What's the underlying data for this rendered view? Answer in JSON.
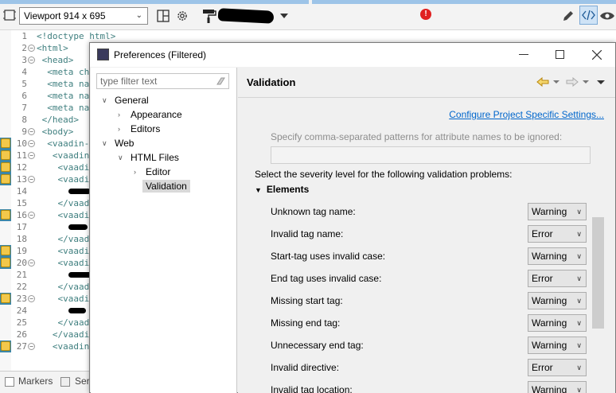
{
  "toolbar": {
    "viewport_label": "Viewport 914 x 695",
    "badge_text": "!"
  },
  "editor": {
    "lines": [
      {
        "n": "1",
        "text": "<!doctype html>",
        "fold": false,
        "warn": false
      },
      {
        "n": "2",
        "text": "<html>",
        "fold": true,
        "warn": false
      },
      {
        "n": "3",
        "text": " <head>",
        "fold": true,
        "warn": false
      },
      {
        "n": "4",
        "text": "  <meta ch",
        "fold": false,
        "warn": false
      },
      {
        "n": "5",
        "text": "  <meta na",
        "fold": false,
        "warn": false
      },
      {
        "n": "6",
        "text": "  <meta na",
        "fold": false,
        "warn": false
      },
      {
        "n": "7",
        "text": "  <meta na",
        "fold": false,
        "warn": false
      },
      {
        "n": "8",
        "text": " </head>",
        "fold": false,
        "warn": false
      },
      {
        "n": "9",
        "text": " <body>",
        "fold": true,
        "warn": false
      },
      {
        "n": "10",
        "text": "  <vaadin-",
        "fold": true,
        "warn": true
      },
      {
        "n": "11",
        "text": "   <vaadin",
        "fold": true,
        "warn": true
      },
      {
        "n": "12",
        "text": "    <vaadi",
        "fold": false,
        "warn": true
      },
      {
        "n": "13",
        "text": "    <vaadi",
        "fold": true,
        "warn": true
      },
      {
        "n": "14",
        "text": "",
        "fold": false,
        "warn": false
      },
      {
        "n": "15",
        "text": "    </vaad",
        "fold": false,
        "warn": false
      },
      {
        "n": "16",
        "text": "    <vaadi",
        "fold": true,
        "warn": true
      },
      {
        "n": "17",
        "text": "",
        "fold": false,
        "warn": false
      },
      {
        "n": "18",
        "text": "    </vaad",
        "fold": false,
        "warn": false
      },
      {
        "n": "19",
        "text": "    <vaadi",
        "fold": false,
        "warn": true
      },
      {
        "n": "20",
        "text": "    <vaadi",
        "fold": true,
        "warn": true
      },
      {
        "n": "21",
        "text": "",
        "fold": false,
        "warn": false
      },
      {
        "n": "22",
        "text": "    </vaad",
        "fold": false,
        "warn": false
      },
      {
        "n": "23",
        "text": "    <vaadi",
        "fold": true,
        "warn": true
      },
      {
        "n": "24",
        "text": "",
        "fold": false,
        "warn": false
      },
      {
        "n": "25",
        "text": "    </vaad",
        "fold": false,
        "warn": false
      },
      {
        "n": "26",
        "text": "   </vaadin",
        "fold": false,
        "warn": false
      },
      {
        "n": "27",
        "text": "   <vaadin",
        "fold": true,
        "warn": true
      }
    ]
  },
  "bottom": {
    "markers_tab": "Markers",
    "second_tab": "Ser"
  },
  "dialog": {
    "title": "Preferences (Filtered)",
    "filter_placeholder": "type filter text",
    "tree": {
      "general": "General",
      "appearance": "Appearance",
      "editors": "Editors",
      "web": "Web",
      "html_files": "HTML Files",
      "editor": "Editor",
      "validation": "Validation"
    },
    "page_title": "Validation",
    "configure_link": "Configure Project Specific Settings...",
    "ignore_hint": "Specify comma-separated patterns for attribute names to be ignored:",
    "severity_text": "Select the severity level for the following validation problems:",
    "section": "Elements",
    "rows": [
      {
        "label": "Unknown tag name:",
        "value": "Warning"
      },
      {
        "label": "Invalid tag name:",
        "value": "Error"
      },
      {
        "label": "Start-tag uses invalid case:",
        "value": "Warning"
      },
      {
        "label": "End tag uses invalid case:",
        "value": "Error"
      },
      {
        "label": "Missing start tag:",
        "value": "Warning"
      },
      {
        "label": "Missing end tag:",
        "value": "Warning"
      },
      {
        "label": "Unnecessary end tag:",
        "value": "Warning"
      },
      {
        "label": "Invalid directive:",
        "value": "Error"
      },
      {
        "label": "Invalid tag location:",
        "value": "Warning"
      }
    ]
  },
  "colors": {
    "link": "#0066cc",
    "warning_marker": "#f2c84b",
    "ruler_highlight": "#3b86a8"
  }
}
